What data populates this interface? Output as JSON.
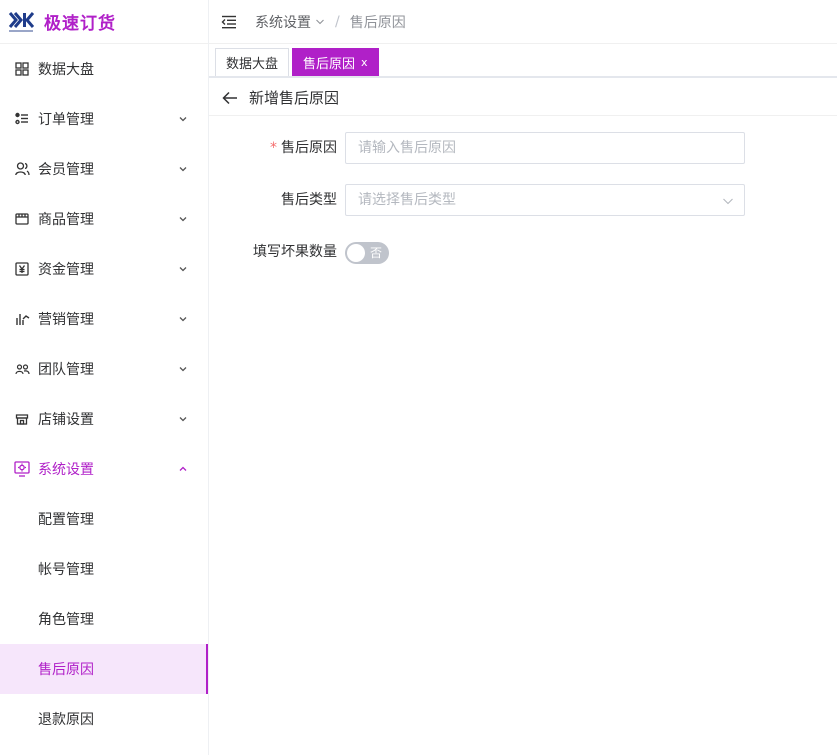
{
  "brand": {
    "name": "极速订货",
    "accent": "#b020c8"
  },
  "sidebar": {
    "items": [
      {
        "label": "数据大盘",
        "icon": "grid-icon",
        "expandable": false
      },
      {
        "label": "订单管理",
        "icon": "list-icon",
        "expandable": true
      },
      {
        "label": "会员管理",
        "icon": "users-icon",
        "expandable": true
      },
      {
        "label": "商品管理",
        "icon": "box-icon",
        "expandable": true
      },
      {
        "label": "资金管理",
        "icon": "yen-icon",
        "expandable": true
      },
      {
        "label": "营销管理",
        "icon": "chart-icon",
        "expandable": true
      },
      {
        "label": "团队管理",
        "icon": "team-icon",
        "expandable": true
      },
      {
        "label": "店铺设置",
        "icon": "store-icon",
        "expandable": true
      },
      {
        "label": "系统设置",
        "icon": "settings-screen-icon",
        "expandable": true,
        "open": true
      }
    ],
    "sub_items": [
      {
        "label": "配置管理"
      },
      {
        "label": "帐号管理"
      },
      {
        "label": "角色管理"
      },
      {
        "label": "售后原因",
        "active": true
      },
      {
        "label": "退款原因"
      }
    ]
  },
  "header": {
    "breadcrumb": [
      "系统设置",
      "售后原因"
    ],
    "separator": "/"
  },
  "tabs": [
    {
      "label": "数据大盘",
      "active": false
    },
    {
      "label": "售后原因",
      "active": true,
      "close": "x"
    }
  ],
  "page": {
    "title": "新增售后原因"
  },
  "form": {
    "reason": {
      "label": "售后原因",
      "required_mark": "*",
      "placeholder": "请输入售后原因",
      "value": ""
    },
    "type": {
      "label": "售后类型",
      "placeholder": "请选择售后类型"
    },
    "bad_count": {
      "label": "填写坏果数量",
      "switch_text": "否",
      "on": false
    }
  }
}
